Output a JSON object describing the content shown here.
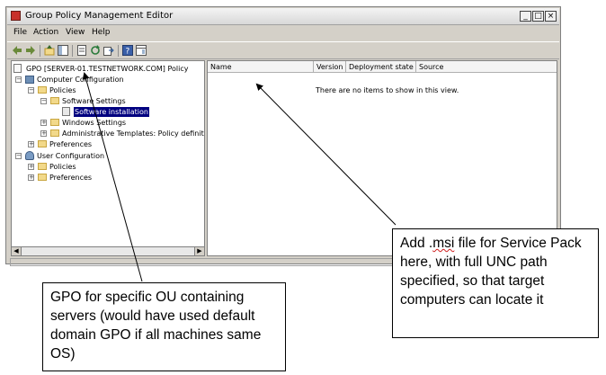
{
  "window": {
    "title": "Group Policy Management Editor",
    "min_label": "_",
    "max_label": "□",
    "close_label": "×"
  },
  "menu": {
    "items": [
      {
        "label": "File"
      },
      {
        "label": "Action"
      },
      {
        "label": "View"
      },
      {
        "label": "Help"
      }
    ]
  },
  "toolbar": {
    "icons": [
      "back-icon",
      "forward-icon",
      "up-icon",
      "show-hide-tree-icon",
      "properties-icon",
      "refresh-icon",
      "export-icon",
      "help-icon",
      "view-icon"
    ]
  },
  "tree": {
    "root": "GPO [SERVER-01.TESTNETWORK.COM] Policy",
    "computer_configuration": "Computer Configuration",
    "policies": "Policies",
    "software_settings": "Software Settings",
    "software_installation": "Software installation",
    "windows_settings": "Windows Settings",
    "admin_templates": "Administrative Templates: Policy definitic",
    "preferences": "Preferences",
    "user_configuration": "User Configuration",
    "user_policies": "Policies",
    "user_preferences": "Preferences"
  },
  "list": {
    "columns": [
      {
        "label": "Name"
      },
      {
        "label": "Version"
      },
      {
        "label": "Deployment state"
      },
      {
        "label": "Source"
      }
    ],
    "empty_message": "There are no items to show in this view."
  },
  "callouts": {
    "right": {
      "before": "Add .",
      "misspelled": "msi",
      "after": " file for Service Pack here,  with full UNC path specified, so that target computers can locate it"
    },
    "left": "GPO for specific OU containing servers (would have used default domain GPO if all machines same OS)"
  },
  "colors": {
    "selection": "#000080",
    "window_chrome": "#d4d0c8"
  }
}
